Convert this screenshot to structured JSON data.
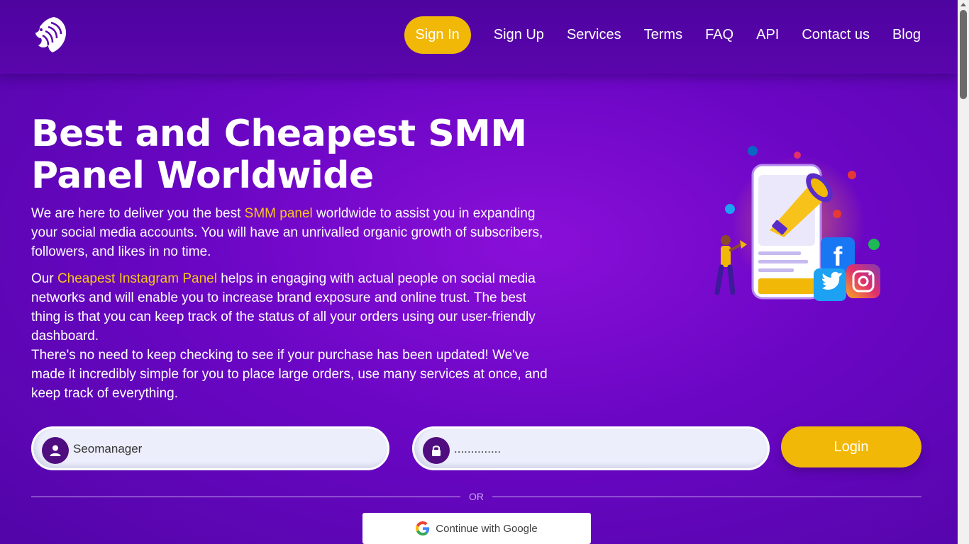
{
  "brand": {
    "logo_icon": "lion-head-icon"
  },
  "nav": {
    "items": [
      {
        "label": "Sign In",
        "active": true
      },
      {
        "label": "Sign Up"
      },
      {
        "label": "Services"
      },
      {
        "label": "Terms"
      },
      {
        "label": "FAQ"
      },
      {
        "label": "API"
      },
      {
        "label": "Contact us"
      },
      {
        "label": "Blog"
      }
    ]
  },
  "hero": {
    "title": "Best and Cheapest SMM Panel Worldwide",
    "p1_before": "We are here to deliver you the best ",
    "p1_link": "SMM panel",
    "p1_after": " worldwide to assist you in expanding your social media accounts. You will have an unrivalled organic growth of subscribers, followers, and likes in no time.",
    "p2_before": "Our ",
    "p2_link": "Cheapest Instagram Panel",
    "p2_after": " helps in engaging with actual people on social media networks and will enable you to increase brand exposure and online trust. The best thing is that you can keep track of the status of all your orders using our user-friendly dashboard.",
    "p3": "There's no need to keep checking to see if your purchase has been updated! We've made it incredibly simple for you to place large orders, use many services at once, and keep track of everything."
  },
  "login": {
    "username_value": "Seomanager",
    "password_value": "..............",
    "button_label": "Login",
    "or_label": "OR",
    "google_label": "Continue with Google"
  },
  "colors": {
    "accent": "#f2b807",
    "background": "#6a06c4",
    "highlight": "#f7c51a"
  }
}
